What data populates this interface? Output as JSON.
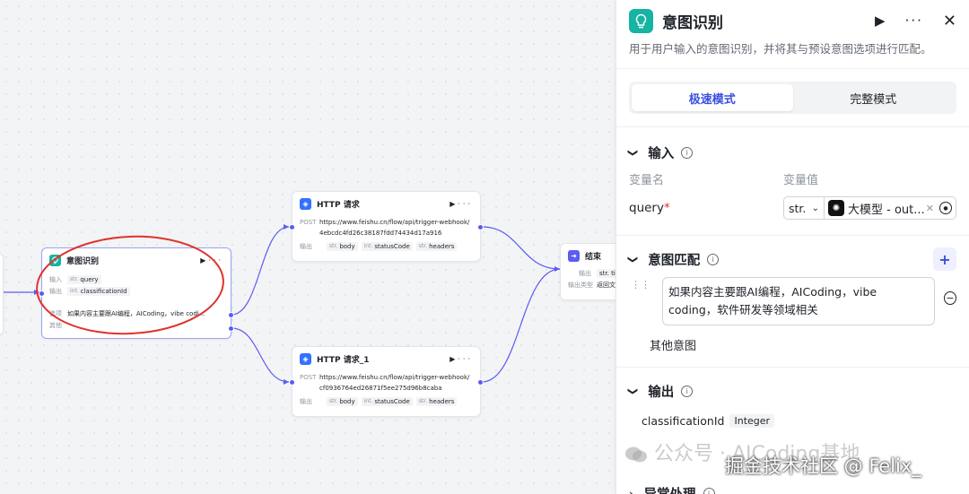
{
  "canvas": {
    "intent_node": {
      "title": "意图识别",
      "input_label": "输入",
      "input_type": "str.",
      "input_var": "query",
      "output_label": "输出",
      "output_type": "int.",
      "output_var": "classificationId",
      "option_label": "选项",
      "option_text": "如果内容主要跟AI编程，AICoding，vibe codi...",
      "other_label": "其他"
    },
    "http1": {
      "title": "HTTP 请求",
      "method": "POST",
      "url": "https://www.feishu.cn/flow/api/trigger-webhook/4ebcdc4fd26c38187fdd74434d17a916",
      "out_label": "输出",
      "outputs": [
        {
          "type": "str.",
          "name": "body"
        },
        {
          "type": "int.",
          "name": "statusCode"
        },
        {
          "type": "str.",
          "name": "headers"
        }
      ]
    },
    "http2": {
      "title": "HTTP 请求_1",
      "method": "POST",
      "url": "https://www.feishu.cn/flow/api/trigger-webhook/cf0936764ed26871f5ee275d96b8caba",
      "out_label": "输出",
      "outputs": [
        {
          "type": "str.",
          "name": "body"
        },
        {
          "type": "int.",
          "name": "statusCode"
        },
        {
          "type": "str.",
          "name": "headers"
        }
      ]
    },
    "end_node": {
      "title": "结束",
      "output_label": "输出",
      "output_tag": "str. titl",
      "output_type_label": "输出类型",
      "output_type_value": "返回文"
    }
  },
  "panel": {
    "title": "意图识别",
    "description": "用于用户输入的意图识别，并将其与预设意图选项进行匹配。",
    "modes": [
      "极速模式",
      "完整模式"
    ],
    "active_mode": "极速模式",
    "input_section": {
      "title": "输入",
      "col_name": "变量名",
      "col_value": "变量值",
      "var_name": "query",
      "required_mark": "*",
      "type": "str.",
      "value": "大模型 - out..."
    },
    "intent_section": {
      "title": "意图匹配",
      "intent_text": "如果内容主要跟AI编程，AICoding，vibe coding，软件研发等领域相关",
      "other": "其他意图"
    },
    "output_section": {
      "title": "输出",
      "var_name": "classificationId",
      "var_type": "Integer"
    },
    "exception_section": {
      "title": "异常处理"
    }
  },
  "overlay": {
    "watermark": "公众号 · AICoding基地",
    "credit": "掘金技术社区 @ Felix_"
  },
  "colors": {
    "accent": "#3b4fe0",
    "intent_icon": "#17b3a3",
    "port": "#5b5cf0",
    "annotation_circle": "#e0322d"
  },
  "icons": {
    "play": "play-icon",
    "more": "more-icon",
    "close": "close-icon",
    "info": "info-icon",
    "plus": "plus-icon",
    "minus": "minus-circle-icon",
    "drag": "drag-handle-icon"
  }
}
